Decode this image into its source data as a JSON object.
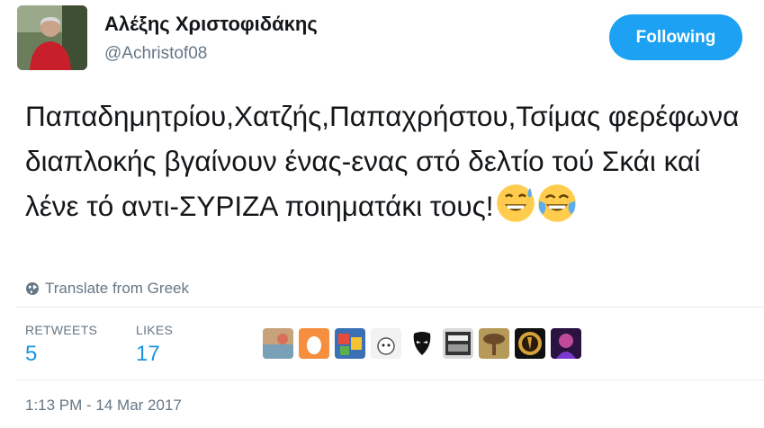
{
  "user": {
    "display_name": "Αλέξης Χριστοφιδάκης",
    "handle": "@Achristof08"
  },
  "follow_button": {
    "label": "Following"
  },
  "tweet": {
    "text": "Παπαδημητρίου,Χατζής,Παπαχρήστου,Τσίμας φερέφωνα διαπλοκής βγαίνουν ένας-ενας στό δελτίο τού Σκάι καί λένε τό αντι-ΣΥΡΙΖΑ ποιηματάκι τους!",
    "emojis": [
      "grinning-sweat-emoji",
      "tears-of-joy-emoji"
    ]
  },
  "translate": {
    "label": "Translate from Greek",
    "icon": "globe-icon"
  },
  "stats": {
    "retweets_label": "RETWEETS",
    "retweets_value": "5",
    "likes_label": "LIKES",
    "likes_value": "17"
  },
  "likers_count_shown": 9,
  "timestamp": "1:13 PM - 14 Mar 2017",
  "colors": {
    "accent": "#1da1f2",
    "stat_value": "#1b95e0",
    "muted": "#657786",
    "divider": "#e6ecf0"
  }
}
